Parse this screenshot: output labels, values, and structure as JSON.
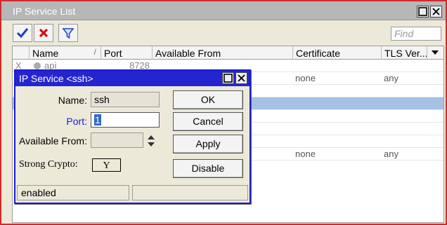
{
  "window": {
    "title": "IP Service List"
  },
  "toolbar": {
    "find_placeholder": "Find"
  },
  "table": {
    "columns": [
      "Name",
      "Port",
      "Available From",
      "Certificate",
      "TLS Ver..."
    ],
    "rows": [
      {
        "flag": "X",
        "name": "api",
        "port": "8728",
        "available_from": "",
        "certificate": "",
        "tls": ""
      },
      {
        "flag": "",
        "name": "",
        "port": "",
        "available_from": "",
        "certificate": "none",
        "tls": "any"
      },
      {
        "flag": "",
        "name": "",
        "port": "",
        "available_from": "",
        "certificate": "",
        "tls": ""
      },
      {
        "flag": "",
        "name": "",
        "port": "",
        "available_from": "",
        "certificate": "",
        "tls": ""
      },
      {
        "flag": "",
        "name": "",
        "port": "",
        "available_from": "",
        "certificate": "",
        "tls": ""
      },
      {
        "flag": "",
        "name": "",
        "port": "",
        "available_from": "",
        "certificate": "",
        "tls": ""
      },
      {
        "flag": "",
        "name": "",
        "port": "",
        "available_from": "",
        "certificate": "",
        "tls": ""
      },
      {
        "flag": "",
        "name": "",
        "port": "",
        "available_from": "",
        "certificate": "none",
        "tls": "any"
      }
    ]
  },
  "dialog": {
    "title": "IP Service <ssh>",
    "name_label": "Name:",
    "name_value": "ssh",
    "port_label": "Port:",
    "port_value": "1",
    "available_from_label": "Available From:",
    "available_from_value": "",
    "strong_crypto_label": "Strong Crypto:",
    "strong_crypto_value": "Y",
    "buttons": {
      "ok": "OK",
      "cancel": "Cancel",
      "apply": "Apply",
      "disable": "Disable"
    },
    "status_left": "enabled",
    "status_right": ""
  },
  "colors": {
    "window_border": "#d32a2a",
    "dialog_title": "#2525d0",
    "selected_row": "#a6c0e6",
    "port_label": "#1a1ad6"
  }
}
